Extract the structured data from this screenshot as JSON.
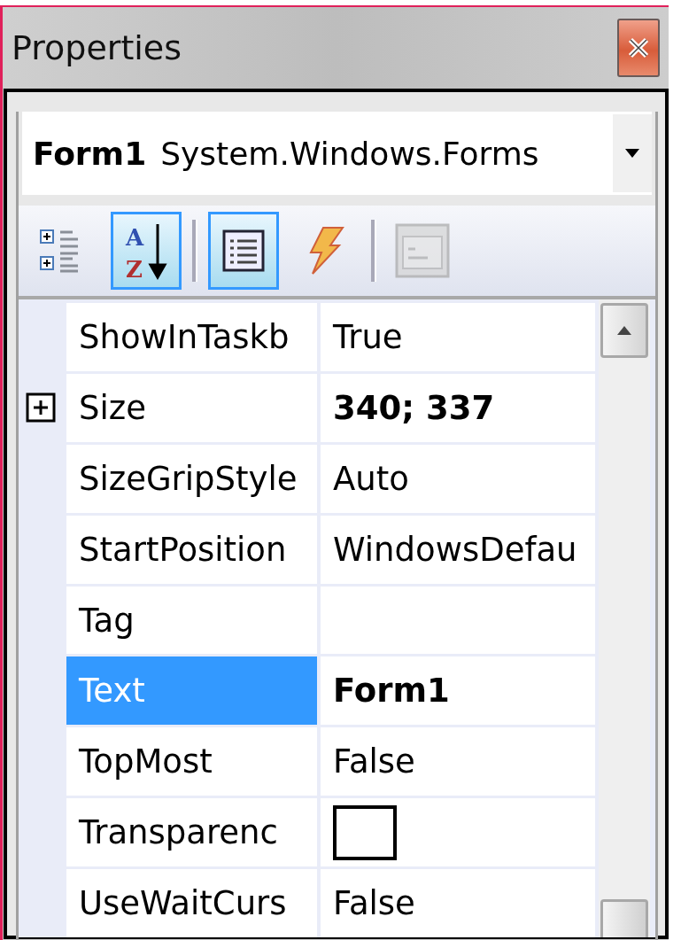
{
  "window": {
    "title": "Properties"
  },
  "object_selector": {
    "name": "Form1",
    "type": "System.Windows.Forms"
  },
  "toolbar": [
    {
      "kind": "categorized",
      "selected": false,
      "disabled": false
    },
    {
      "kind": "alphabetical",
      "selected": true,
      "disabled": false,
      "letters": [
        "A",
        "Z"
      ]
    },
    {
      "kind": "separator"
    },
    {
      "kind": "properties",
      "selected": true,
      "disabled": false
    },
    {
      "kind": "events",
      "selected": false,
      "disabled": false
    },
    {
      "kind": "separator"
    },
    {
      "kind": "property-pages",
      "selected": false,
      "disabled": true
    }
  ],
  "properties": [
    {
      "name": "ShowInTaskb",
      "value": "True",
      "kind": "text",
      "bold": false,
      "expandable": false,
      "selected": false
    },
    {
      "name": "Size",
      "value": "340; 337",
      "kind": "text",
      "bold": true,
      "expandable": true,
      "expanded": false,
      "selected": false
    },
    {
      "name": "SizeGripStyle",
      "value": "Auto",
      "kind": "text",
      "bold": false,
      "expandable": false,
      "selected": false
    },
    {
      "name": "StartPosition",
      "value": "WindowsDefau",
      "kind": "text",
      "bold": false,
      "expandable": false,
      "selected": false
    },
    {
      "name": "Tag",
      "kind": "empty",
      "expandable": false,
      "selected": false
    },
    {
      "name": "Text",
      "value": "Form1",
      "kind": "text",
      "bold": true,
      "expandable": false,
      "selected": true
    },
    {
      "name": "TopMost",
      "value": "False",
      "kind": "text",
      "bold": false,
      "expandable": false,
      "selected": false
    },
    {
      "name": "Transparenc",
      "kind": "color",
      "color": "#ffffff",
      "expandable": false,
      "selected": false
    },
    {
      "name": "UseWaitCurs",
      "value": "False",
      "kind": "text",
      "bold": false,
      "expandable": false,
      "selected": false
    }
  ]
}
